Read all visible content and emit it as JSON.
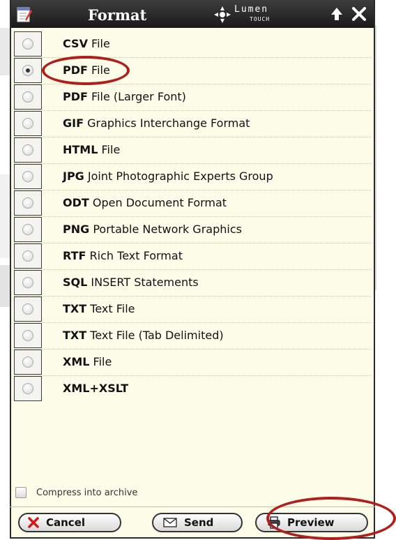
{
  "window": {
    "title": "Format",
    "logo": {
      "name": "Lumen",
      "sub": "TOUCH"
    }
  },
  "formats": [
    {
      "code": "CSV",
      "desc": "File",
      "selected": false
    },
    {
      "code": "PDF",
      "desc": "File",
      "selected": true
    },
    {
      "code": "PDF",
      "desc": "File (Larger Font)",
      "selected": false
    },
    {
      "code": "GIF",
      "desc": "Graphics Interchange Format",
      "selected": false
    },
    {
      "code": "HTML",
      "desc": "File",
      "selected": false
    },
    {
      "code": "JPG",
      "desc": "Joint Photographic Experts Group",
      "selected": false
    },
    {
      "code": "ODT",
      "desc": "Open Document Format",
      "selected": false
    },
    {
      "code": "PNG",
      "desc": "Portable Network Graphics",
      "selected": false
    },
    {
      "code": "RTF",
      "desc": "Rich Text Format",
      "selected": false
    },
    {
      "code": "SQL",
      "desc": "INSERT Statements",
      "selected": false
    },
    {
      "code": "TXT",
      "desc": "Text File",
      "selected": false
    },
    {
      "code": "TXT",
      "desc": "Text File (Tab Delimited)",
      "selected": false
    },
    {
      "code": "XML",
      "desc": "File",
      "selected": false
    },
    {
      "code": "XML+XSLT",
      "desc": "",
      "selected": false
    }
  ],
  "options": {
    "compress_label": "Compress into archive",
    "compress_checked": false
  },
  "buttons": {
    "cancel": "Cancel",
    "send": "Send",
    "preview": "Preview"
  },
  "colors": {
    "highlight": "#b01e1e",
    "panel_bg": "#fefde9",
    "titlebar": "#2a2a2a"
  },
  "icons": {
    "title": "notepad-icon",
    "logo": "compass-arrows-icon",
    "up": "arrow-up-icon",
    "close": "close-icon",
    "cancel": "red-x-icon",
    "send": "envelope-icon",
    "preview": "printer-icon"
  }
}
